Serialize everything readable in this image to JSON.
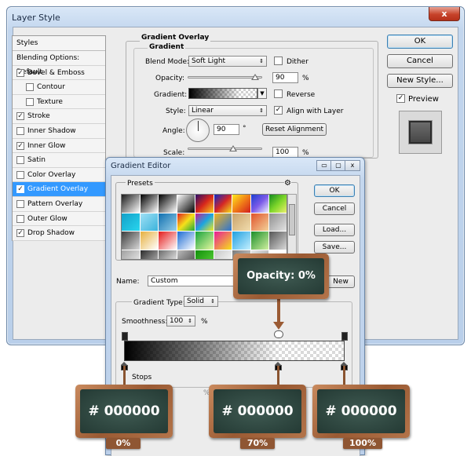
{
  "layer_style": {
    "title": "Layer Style",
    "close_glyph": "x",
    "styles_header": "Styles",
    "style_items": [
      {
        "label": "Blending Options: Default",
        "type": "plain",
        "checked": false
      },
      {
        "label": "Bevel & Emboss",
        "type": "check",
        "checked": true
      },
      {
        "label": "Contour",
        "type": "sub",
        "checked": false
      },
      {
        "label": "Texture",
        "type": "sub",
        "checked": false
      },
      {
        "label": "Stroke",
        "type": "check",
        "checked": true
      },
      {
        "label": "Inner Shadow",
        "type": "check",
        "checked": false
      },
      {
        "label": "Inner Glow",
        "type": "check",
        "checked": true
      },
      {
        "label": "Satin",
        "type": "check",
        "checked": false
      },
      {
        "label": "Color Overlay",
        "type": "check",
        "checked": false
      },
      {
        "label": "Gradient Overlay",
        "type": "check",
        "checked": true,
        "selected": true
      },
      {
        "label": "Pattern Overlay",
        "type": "check",
        "checked": false
      },
      {
        "label": "Outer Glow",
        "type": "check",
        "checked": false
      },
      {
        "label": "Drop Shadow",
        "type": "check",
        "checked": true
      }
    ],
    "panel": {
      "section_title": "Gradient Overlay",
      "group_title": "Gradient",
      "blend_mode_label": "Blend Mode:",
      "blend_mode_value": "Soft Light",
      "dither_label": "Dither",
      "dither_checked": false,
      "opacity_label": "Opacity:",
      "opacity_value": "90",
      "opacity_unit": "%",
      "gradient_label": "Gradient:",
      "reverse_label": "Reverse",
      "reverse_checked": false,
      "style_label": "Style:",
      "style_value": "Linear",
      "align_label": "Align with Layer",
      "align_checked": true,
      "angle_label": "Angle:",
      "angle_value": "90",
      "angle_unit": "°",
      "reset_label": "Reset Alignment",
      "scale_label": "Scale:",
      "scale_value": "100",
      "scale_unit": "%"
    },
    "buttons": {
      "ok": "OK",
      "cancel": "Cancel",
      "new_style": "New Style...",
      "preview_label": "Preview",
      "preview_checked": true
    }
  },
  "gradient_editor": {
    "title": "Gradient Editor",
    "controls": [
      "▭",
      "▢",
      "x"
    ],
    "presets_label": "Presets",
    "presets_gear": "⚙",
    "buttons": {
      "ok": "OK",
      "cancel": "Cancel",
      "load": "Load...",
      "save": "Save..."
    },
    "name_label": "Name:",
    "name_value": "Custom",
    "new_label": "New",
    "type_label": "Gradient Type:",
    "type_value": "Solid",
    "smoothness_label": "Smoothness:",
    "smoothness_value": "100",
    "smoothness_unit": "%",
    "stops_label": "Stops",
    "pct_sign": "%"
  },
  "callouts": {
    "opacity": "Opacity: 0%",
    "stops": [
      {
        "color": "# 000000",
        "pct": "0%"
      },
      {
        "color": "# 000000",
        "pct": "70%"
      },
      {
        "color": "# 000000",
        "pct": "100%"
      }
    ]
  },
  "colors": {
    "selection": "#3399ff",
    "board_green": "#2f4a43",
    "board_wood": "#a8683f"
  }
}
